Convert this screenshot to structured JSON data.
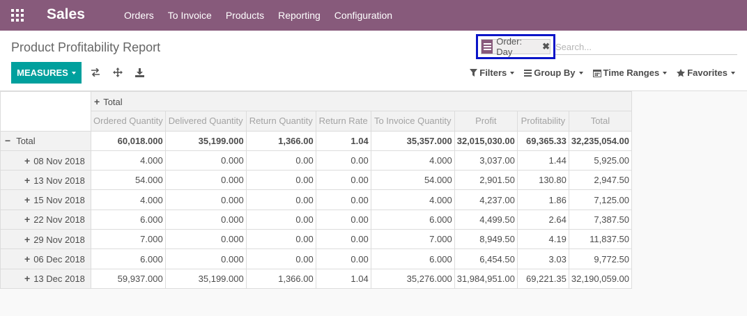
{
  "navbar": {
    "app_name": "Sales",
    "menu": [
      "Orders",
      "To Invoice",
      "Products",
      "Reporting",
      "Configuration"
    ]
  },
  "page": {
    "title": "Product Profitability Report"
  },
  "search": {
    "facet_value": "Order: Day",
    "placeholder": "Search..."
  },
  "toolbar": {
    "measures_label": "MEASURES",
    "filters_label": "Filters",
    "groupby_label": "Group By",
    "timeranges_label": "Time Ranges",
    "favorites_label": "Favorites"
  },
  "pivot": {
    "col_header_total": "Total",
    "measures": [
      "Ordered Quantity",
      "Delivered Quantity",
      "Return Quantity",
      "Return Rate",
      "To Invoice Quantity",
      "Profit",
      "Profitability",
      "Total"
    ],
    "total_row": {
      "label": "Total",
      "values": [
        "60,018.000",
        "35,199.000",
        "1,366.00",
        "1.04",
        "35,357.000",
        "32,015,030.00",
        "69,365.33",
        "32,235,054.00"
      ]
    },
    "rows": [
      {
        "label": "08 Nov 2018",
        "values": [
          "4.000",
          "0.000",
          "0.00",
          "0.00",
          "4.000",
          "3,037.00",
          "1.44",
          "5,925.00"
        ]
      },
      {
        "label": "13 Nov 2018",
        "values": [
          "54.000",
          "0.000",
          "0.00",
          "0.00",
          "54.000",
          "2,901.50",
          "130.80",
          "2,947.50"
        ]
      },
      {
        "label": "15 Nov 2018",
        "values": [
          "4.000",
          "0.000",
          "0.00",
          "0.00",
          "4.000",
          "4,237.00",
          "1.86",
          "7,125.00"
        ]
      },
      {
        "label": "22 Nov 2018",
        "values": [
          "6.000",
          "0.000",
          "0.00",
          "0.00",
          "6.000",
          "4,499.50",
          "2.64",
          "7,387.50"
        ]
      },
      {
        "label": "29 Nov 2018",
        "values": [
          "7.000",
          "0.000",
          "0.00",
          "0.00",
          "7.000",
          "8,949.50",
          "4.19",
          "11,837.50"
        ]
      },
      {
        "label": "06 Dec 2018",
        "values": [
          "6.000",
          "0.000",
          "0.00",
          "0.00",
          "6.000",
          "6,454.50",
          "3.03",
          "9,772.50"
        ]
      },
      {
        "label": "13 Dec 2018",
        "values": [
          "59,937.000",
          "35,199.000",
          "1,366.00",
          "1.04",
          "35,276.000",
          "31,984,951.00",
          "69,221.35",
          "32,190,059.00"
        ]
      }
    ]
  }
}
